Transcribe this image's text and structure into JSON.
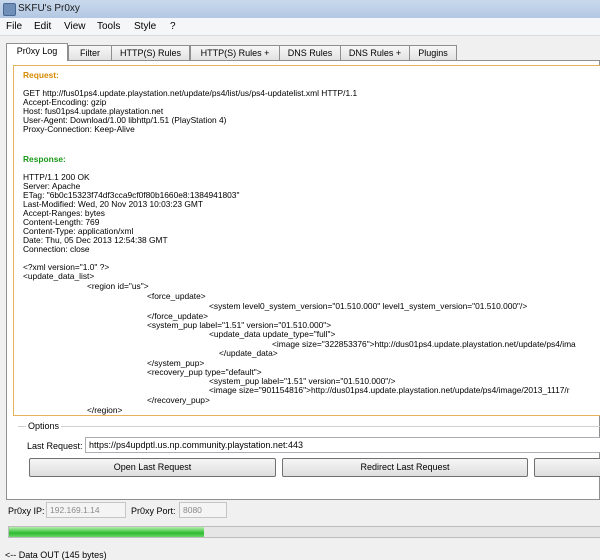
{
  "window": {
    "title": "SKFU's Pr0xy",
    "icon": "app-icon"
  },
  "menu": [
    "File",
    "Edit",
    "View",
    "Tools",
    "Style",
    "?"
  ],
  "tabs": [
    "Pr0xy Log",
    "Filter",
    "HTTP(S) Rules",
    "HTTP(S) Rules +",
    "DNS Rules",
    "DNS Rules +",
    "Plugins"
  ],
  "active_tab": "Pr0xy Log",
  "log": {
    "request_heading": "Request:",
    "request_lines": [
      "GET http://fus01ps4.update.playstation.net/update/ps4/list/us/ps4-updatelist.xml HTTP/1.1",
      "Accept-Encoding: gzip",
      "Host: fus01ps4.update.playstation.net",
      "User-Agent: Download/1.00 libhttp/1.51 (PlayStation 4)",
      "Proxy-Connection: Keep-Alive"
    ],
    "response_heading": "Response:",
    "response_lines": [
      "HTTP/1.1 200 OK",
      "Server: Apache",
      "ETag: \"6b0c15323f74df3cca9cf0f80b1660e8:1384941803\"",
      "Last-Modified: Wed, 20 Nov 2013 10:03:23 GMT",
      "Accept-Ranges: bytes",
      "Content-Length: 769",
      "Content-Type: application/xml",
      "Date: Thu, 05 Dec 2013 12:54:38 GMT",
      "Connection: close"
    ],
    "xml_lines": [
      "<?xml version=\"1.0\" ?>",
      "<update_data_list>",
      "<region id=\"us\">",
      "<force_update>",
      "<system level0_system_version=\"01.510.000\" level1_system_version=\"01.510.000\"/>",
      "</force_update>",
      "<system_pup label=\"1.51\" version=\"01.510.000\">",
      "<update_data update_type=\"full\">",
      "<image size=\"322853376\">http://dus01ps4.update.playstation.net/update/ps4/ima",
      "</update_data>",
      "</system_pup>",
      "<recovery_pup type=\"default\">",
      "<system_pup label=\"1.51\" version=\"01.510.000\"/>",
      "<image size=\"901154816\">http://dus01ps4.update.playstation.net/update/ps4/image/2013_1117/r",
      "</recovery_pup>",
      "</region>"
    ]
  },
  "options": {
    "title": "Options",
    "last_request_label": "Last Request:",
    "last_request_value": "https://ps4updptl.us.np.community.playstation.net:443",
    "open_button": "Open Last Request",
    "redirect_button": "Redirect Last Request",
    "third_button": ""
  },
  "proxy": {
    "ip_label": "Pr0xy IP:",
    "ip_value": "192.169.1.14",
    "port_label": "Pr0xy Port:",
    "port_value": "8080"
  },
  "progress": {
    "fraction": 0.33,
    "color": "#2fbb2f"
  },
  "status_text": "<-- Data OUT (145 bytes)"
}
